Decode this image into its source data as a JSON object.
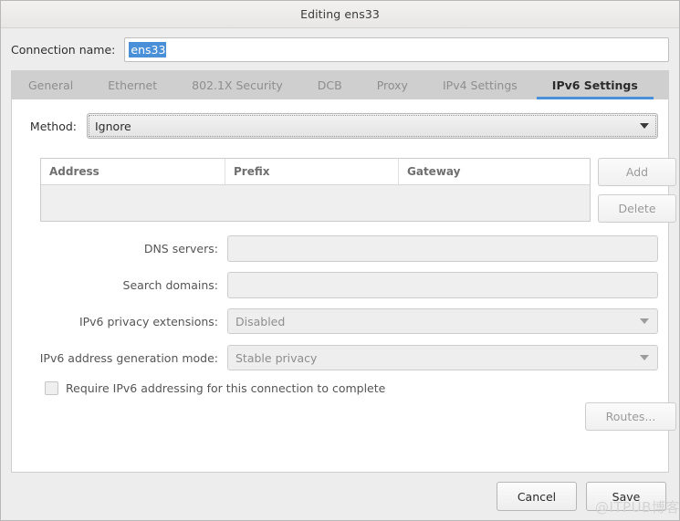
{
  "window": {
    "title": "Editing ens33"
  },
  "connection": {
    "label": "Connection name:",
    "value": "ens33",
    "placeholder": ""
  },
  "tabs": [
    {
      "label": "General",
      "active": false
    },
    {
      "label": "Ethernet",
      "active": false
    },
    {
      "label": "802.1X Security",
      "active": false
    },
    {
      "label": "DCB",
      "active": false
    },
    {
      "label": "Proxy",
      "active": false
    },
    {
      "label": "IPv4 Settings",
      "active": false
    },
    {
      "label": "IPv6 Settings",
      "active": true
    }
  ],
  "method": {
    "label": "Method:",
    "value": "Ignore"
  },
  "address_table": {
    "columns": [
      "Address",
      "Prefix",
      "Gateway"
    ],
    "rows": [],
    "add_label": "Add",
    "delete_label": "Delete"
  },
  "dns": {
    "label": "DNS servers:",
    "value": ""
  },
  "search_domains": {
    "label": "Search domains:",
    "value": ""
  },
  "privacy_extensions": {
    "label": "IPv6 privacy extensions:",
    "value": "Disabled"
  },
  "address_generation_mode": {
    "label": "IPv6 address generation mode:",
    "value": "Stable privacy"
  },
  "require_ipv6": {
    "label": "Require IPv6 addressing for this connection to complete",
    "checked": false
  },
  "routes": {
    "label": "Routes..."
  },
  "actions": {
    "cancel_label": "Cancel",
    "save_label": "Save"
  },
  "watermark": {
    "text": "@ITPUB博客"
  },
  "colors": {
    "accent": "#4a90d9",
    "selection": "#4a90d9",
    "window_bg": "#ededed",
    "content_bg": "#ffffff",
    "tabstrip_bg": "#cfcfcf",
    "disabled_text": "#9a9a9a"
  }
}
